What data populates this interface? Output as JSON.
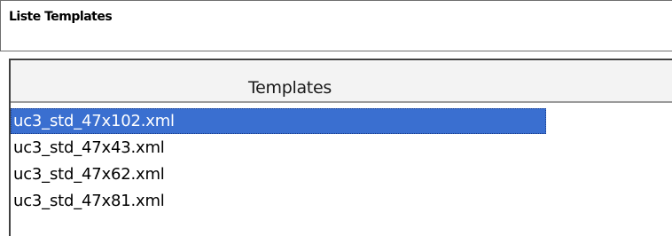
{
  "panel": {
    "title": "Liste Templates"
  },
  "list": {
    "column_header": "Templates",
    "items": [
      {
        "label": "uc3_std_47x102.xml",
        "selected": true
      },
      {
        "label": "uc3_std_47x43.xml",
        "selected": false
      },
      {
        "label": "uc3_std_47x62.xml",
        "selected": false
      },
      {
        "label": "uc3_std_47x81.xml",
        "selected": false
      }
    ],
    "selection_color": "#3a6fd0"
  }
}
